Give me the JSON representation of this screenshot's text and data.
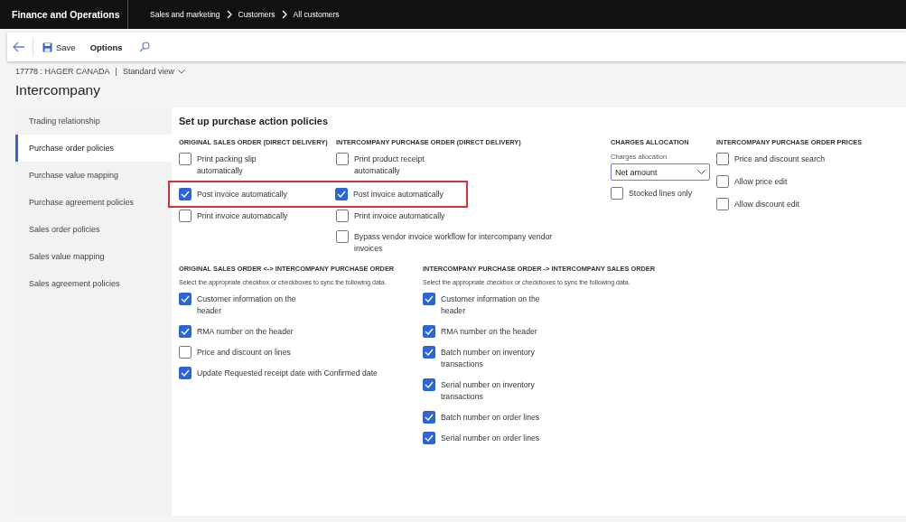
{
  "app": {
    "title": "Finance and Operations",
    "breadcrumb": [
      "Sales and marketing",
      "Customers",
      "All customers"
    ]
  },
  "toolbar": {
    "buttons": [
      "Save",
      "Options"
    ]
  },
  "record": {
    "id": "17778 : HAGER CANADA",
    "separator": "|",
    "view": "Standard view"
  },
  "page_title": "Intercompany",
  "nav": {
    "items": [
      {
        "label": "Trading relationship",
        "selected": false
      },
      {
        "label": "Purchase order policies",
        "selected": true
      },
      {
        "label": "Purchase value mapping",
        "selected": false
      },
      {
        "label": "Purchase agreement policies",
        "selected": false
      },
      {
        "label": "Sales order policies",
        "selected": false
      },
      {
        "label": "Sales value mapping",
        "selected": false
      },
      {
        "label": "Sales agreement policies",
        "selected": false
      }
    ]
  },
  "section": {
    "title": "Set up purchase action policies",
    "groups": [
      {
        "heading": "ORIGINAL SALES ORDER (DIRECT DELIVERY)",
        "options": [
          {
            "label": "Print packing slip automatically",
            "checked": false,
            "highlighted": false
          },
          {
            "label": "Post invoice automatically",
            "checked": true,
            "highlighted": true
          },
          {
            "label": "Print invoice automatically",
            "checked": false,
            "highlighted": false
          }
        ]
      },
      {
        "heading": "INTERCOMPANY PURCHASE ORDER (DIRECT DELIVERY)",
        "options": [
          {
            "label": "Print product receipt automatically",
            "checked": false,
            "highlighted": false
          },
          {
            "label": "Post invoice automatically",
            "checked": true,
            "highlighted": true
          },
          {
            "label": "Print invoice automatically",
            "checked": false,
            "highlighted": false
          },
          {
            "label": "Bypass vendor invoice workflow for intercompany vendor invoices",
            "checked": false,
            "highlighted": false
          }
        ]
      }
    ],
    "charges": {
      "heading": "CHARGES ALLOCATION",
      "field_label": "Charges allocation",
      "value": "Net amount",
      "options": [
        {
          "label": "Stocked lines only",
          "checked": false
        }
      ]
    },
    "prices": {
      "heading": "INTERCOMPANY PURCHASE ORDER PRICES",
      "options": [
        {
          "label": "Price and discount search",
          "checked": false
        },
        {
          "label": "Allow price edit",
          "checked": false
        },
        {
          "label": "Allow discount edit",
          "checked": false
        }
      ]
    },
    "sync_groups": [
      {
        "heading": "ORIGINAL SALES ORDER <-> INTERCOMPANY PURCHASE ORDER",
        "hint": "Select the appropriate checkbox or checkboxes to sync the following data.",
        "options": [
          {
            "label": "Customer information on the header",
            "checked": true
          },
          {
            "label": "RMA number on the header",
            "checked": true
          },
          {
            "label": "Price and discount on lines",
            "checked": false
          },
          {
            "label": "Update Requested receipt date with Confirmed date",
            "checked": true
          }
        ]
      },
      {
        "heading": "INTERCOMPANY PURCHASE ORDER -> INTERCOMPANY SALES ORDER",
        "hint": "Select the appropriate checkbox or checkboxes to sync the following data.",
        "options": [
          {
            "label": "Customer information on the header",
            "checked": true
          },
          {
            "label": "RMA number on the header",
            "checked": true
          },
          {
            "label": "Batch number on inventory transactions",
            "checked": true
          },
          {
            "label": "Serial number on inventory transactions",
            "checked": true
          },
          {
            "label": "Batch number on order lines",
            "checked": true
          },
          {
            "label": "Serial number on order lines",
            "checked": true
          }
        ]
      }
    ]
  }
}
